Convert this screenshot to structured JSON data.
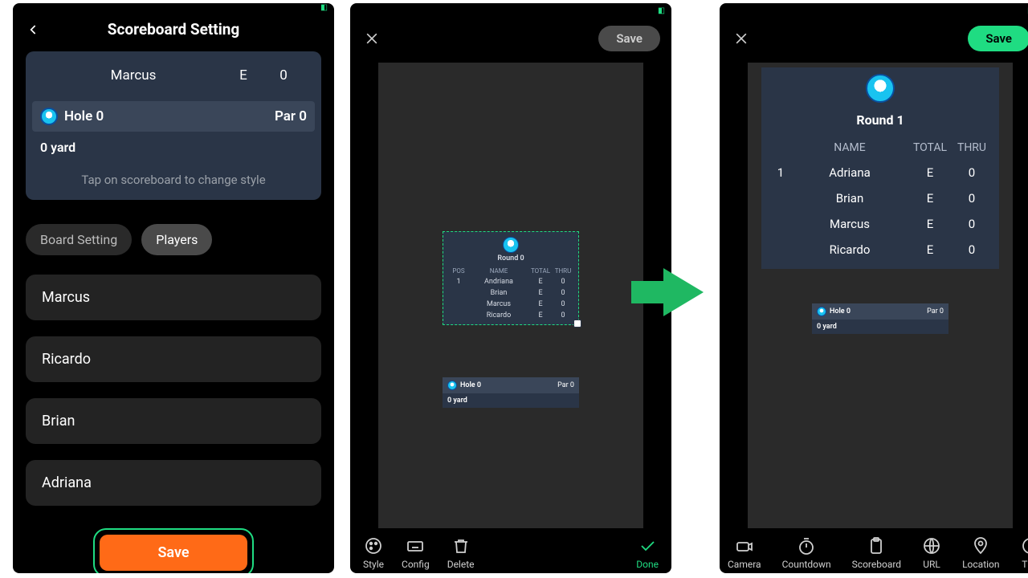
{
  "screen1": {
    "title": "Scoreboard Setting",
    "preview_player": {
      "name": "Marcus",
      "total": "E",
      "thru": "0"
    },
    "hole_label": "Hole 0",
    "par_label": "Par 0",
    "yard_label": "0 yard",
    "tap_hint": "Tap on scoreboard to change style",
    "tabs": {
      "board": "Board Setting",
      "players": "Players"
    },
    "players": [
      "Marcus",
      "Ricardo",
      "Brian",
      "Adriana"
    ],
    "save": "Save"
  },
  "screen2": {
    "save": "Save",
    "board": {
      "round": "Round 0",
      "cols": {
        "pos": "POS",
        "name": "NAME",
        "total": "TOTAL",
        "thru": "THRU"
      },
      "rows": [
        {
          "pos": "1",
          "name": "Andriana",
          "total": "E",
          "thru": "0"
        },
        {
          "pos": "",
          "name": "Brian",
          "total": "E",
          "thru": "0"
        },
        {
          "pos": "",
          "name": "Marcus",
          "total": "E",
          "thru": "0"
        },
        {
          "pos": "",
          "name": "Ricardo",
          "total": "E",
          "thru": "0"
        }
      ]
    },
    "holecard": {
      "hole": "Hole 0",
      "par": "Par 0",
      "yard": "0 yard"
    },
    "toolbar": {
      "style": "Style",
      "config": "Config",
      "delete": "Delete",
      "done": "Done"
    }
  },
  "screen3": {
    "save": "Save",
    "board": {
      "round": "Round 1",
      "cols": {
        "name": "NAME",
        "total": "TOTAL",
        "thru": "THRU"
      },
      "rows": [
        {
          "pos": "1",
          "name": "Adriana",
          "total": "E",
          "thru": "0"
        },
        {
          "pos": "",
          "name": "Brian",
          "total": "E",
          "thru": "0"
        },
        {
          "pos": "",
          "name": "Marcus",
          "total": "E",
          "thru": "0"
        },
        {
          "pos": "",
          "name": "Ricardo",
          "total": "E",
          "thru": "0"
        }
      ]
    },
    "holecard": {
      "hole": "Hole 0",
      "par": "Par 0",
      "yard": "0 yard"
    },
    "toolbar": {
      "camera": "Camera",
      "countdown": "Countdown",
      "scoreboard": "Scoreboard",
      "url": "URL",
      "location": "Location",
      "time": "Tim"
    }
  }
}
